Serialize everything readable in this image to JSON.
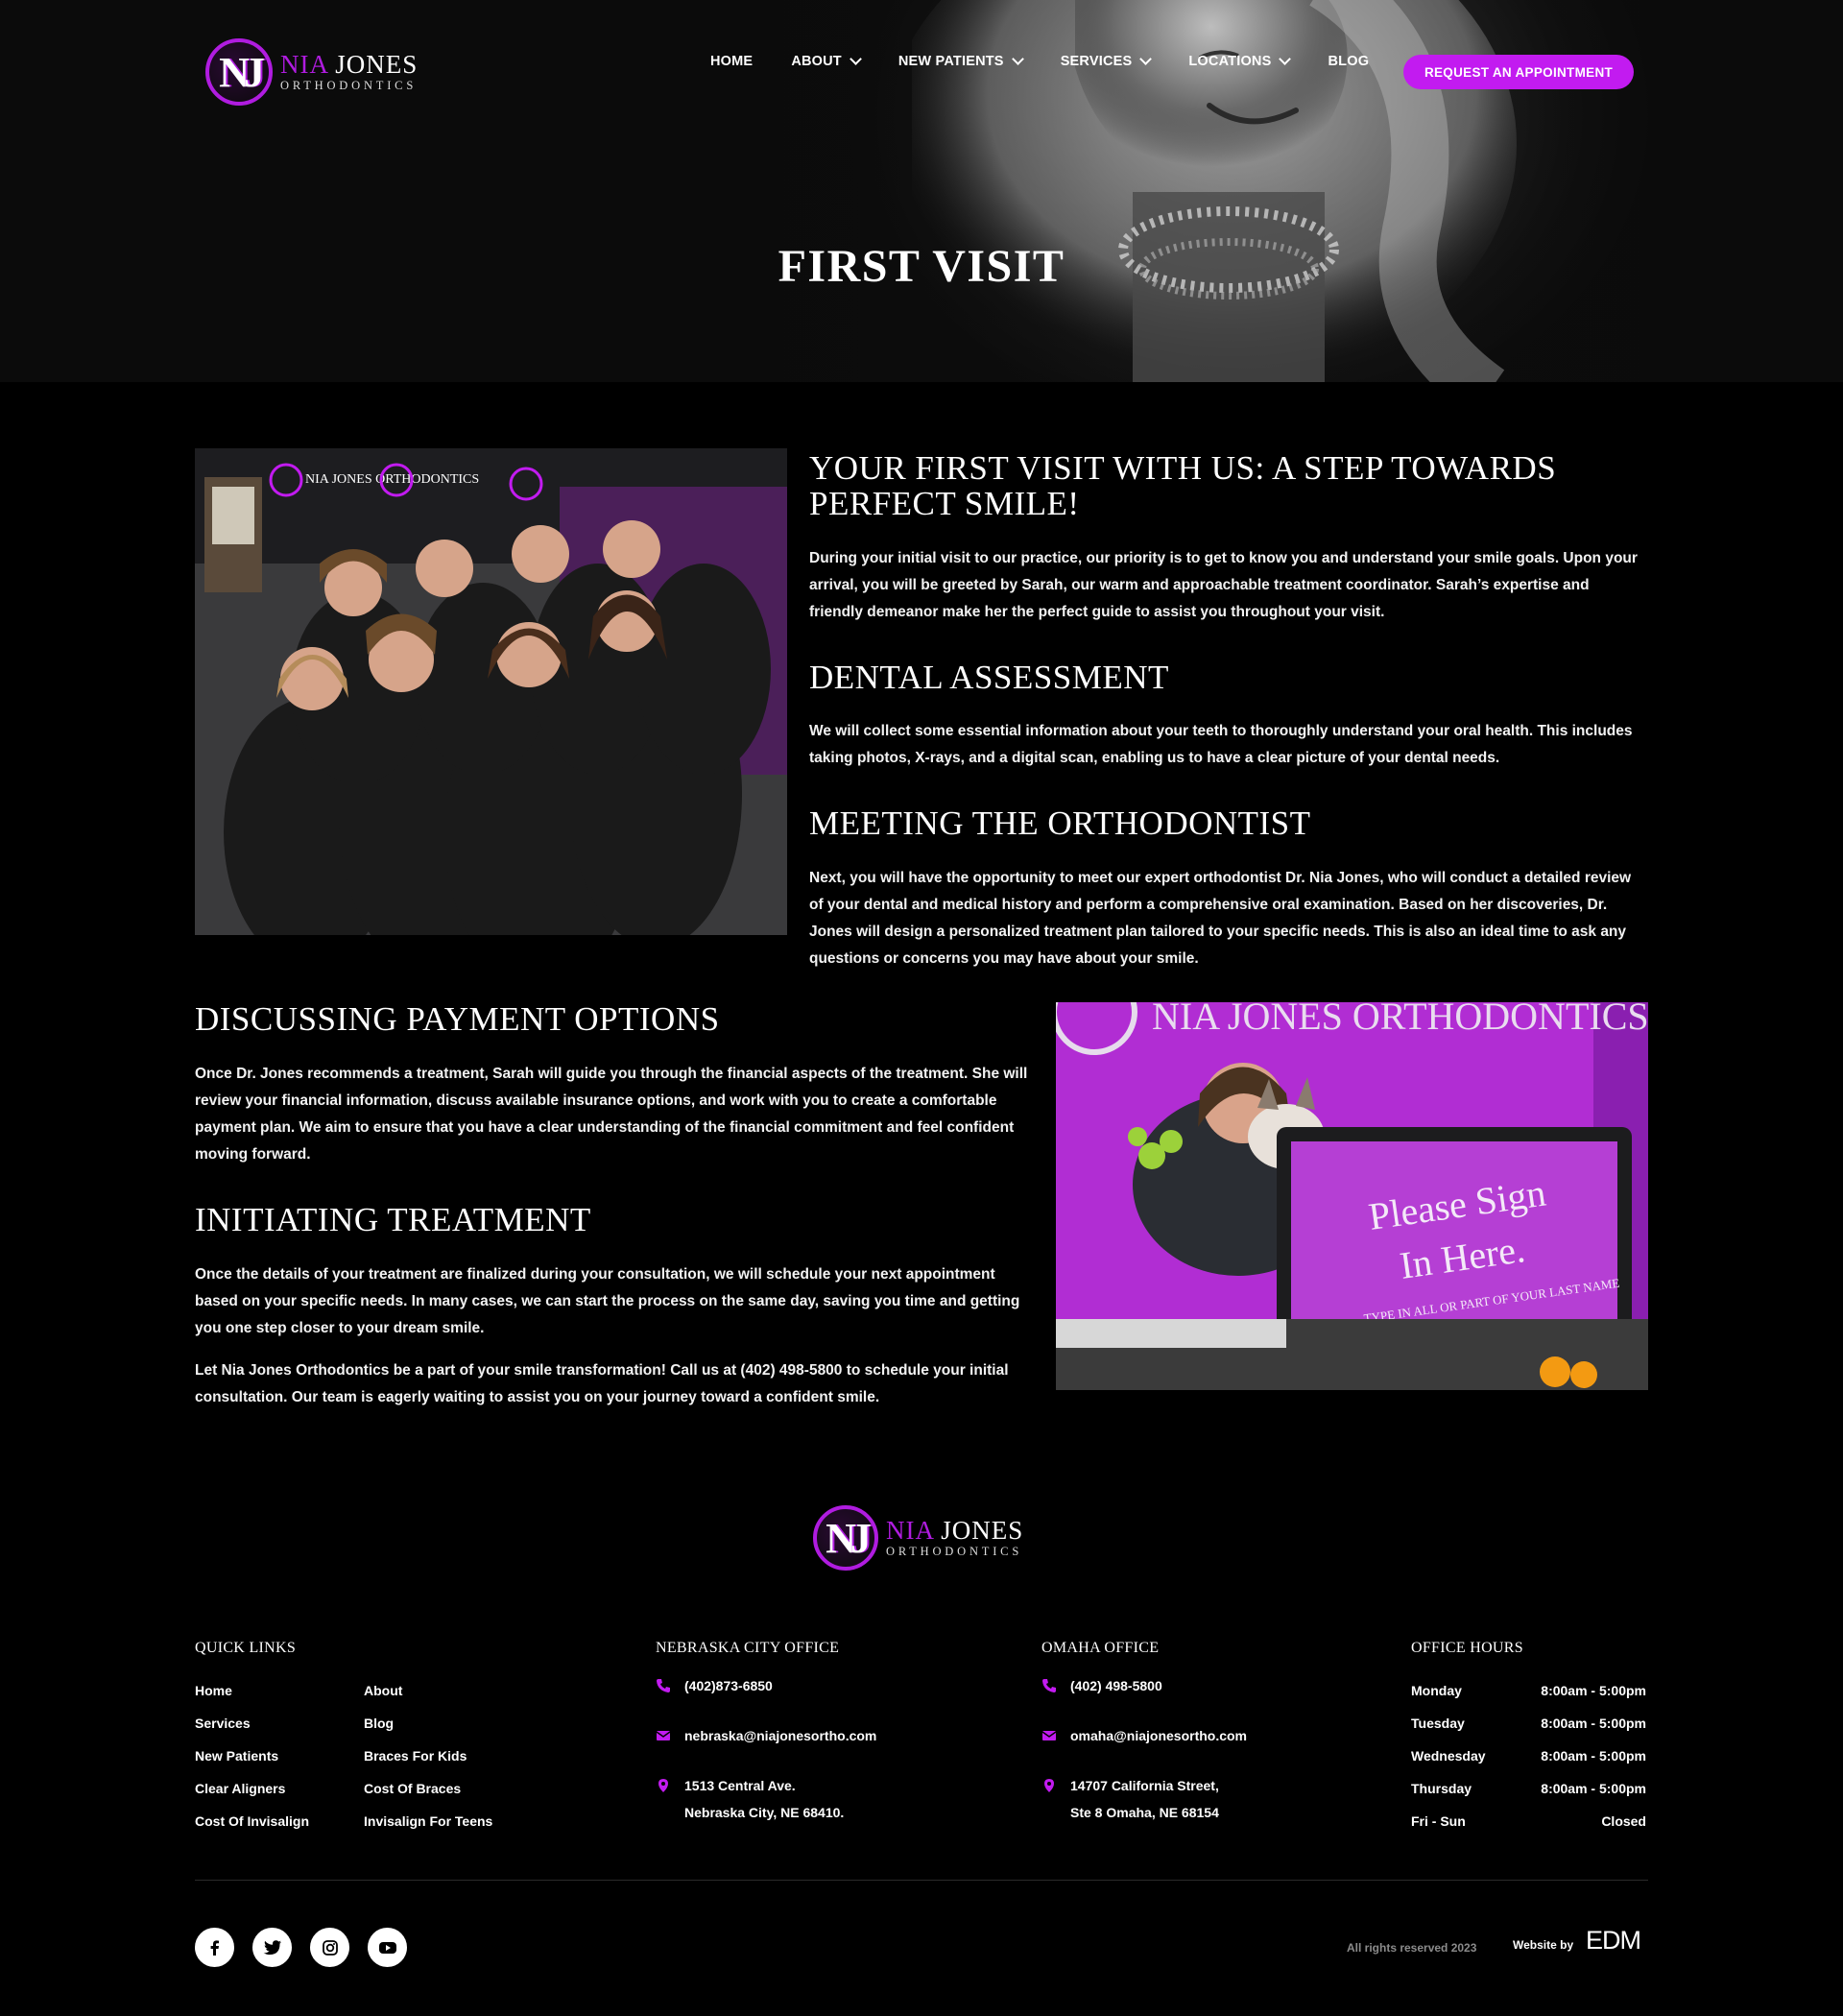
{
  "brand": {
    "monogram": "NJ",
    "name_first": "NIA",
    "name_last": "JONES",
    "subtitle": "ORTHODONTICS"
  },
  "nav": {
    "home": "HOME",
    "about": "ABOUT",
    "new_patients": "NEW PATIENTS",
    "services": "SERVICES",
    "locations": "LOCATIONS",
    "blog": "BLOG",
    "cta": "REQUEST AN APPOINTMENT"
  },
  "hero": {
    "title": "FIRST VISIT"
  },
  "sections": {
    "first_visit": {
      "heading": "YOUR FIRST VISIT WITH US: A STEP TOWARDS PERFECT SMILE!",
      "body": "During your initial visit to our practice, our priority is to get to know you and understand your smile goals. Upon your arrival, you will be greeted by Sarah, our warm and approachable treatment coordinator. Sarah’s expertise and friendly demeanor make her the perfect guide to assist you throughout your visit."
    },
    "dental_assessment": {
      "heading": "DENTAL ASSESSMENT",
      "body": "We will collect some essential information about your teeth to thoroughly understand your oral health. This includes taking photos, X-rays, and a digital scan, enabling us to have a clear picture of your dental needs."
    },
    "meeting": {
      "heading": "MEETING THE ORTHODONTIST",
      "body": "Next, you will have the opportunity to meet our expert orthodontist Dr. Nia Jones, who will conduct a detailed review of your dental and medical history and perform a comprehensive oral examination. Based on her discoveries, Dr. Jones will design a personalized treatment plan tailored to your specific needs. This is also an ideal time to ask any questions or concerns you may have about your smile."
    },
    "payment": {
      "heading": "DISCUSSING PAYMENT OPTIONS",
      "body": "Once Dr. Jones recommends a treatment, Sarah will guide you through the financial aspects of the treatment. She will review your financial information, discuss available insurance options, and work with you to create a comfortable payment plan. We aim to ensure that you have a clear understanding of the financial commitment and feel confident moving forward."
    },
    "treatment": {
      "heading": "INITIATING TREATMENT",
      "body": "Once the details of your treatment are finalized during your consultation, we will schedule your next appointment based on your specific needs. In many cases, we can start the process on the same day, saving you time and getting you one step closer to your dream smile.",
      "body2": "Let Nia Jones Orthodontics be a part of your smile transformation! Call us at (402) 498-5800 to schedule your initial consultation. Our team is eagerly waiting to assist you on your journey toward a confident smile."
    }
  },
  "photos": {
    "team_wall_text": "NIA JONES ORTHODONTICS",
    "sign_line1": "Please Sign",
    "sign_line2": "In Here.",
    "sign_line3": "TYPE IN ALL OR PART OF YOUR LAST NAME",
    "wall_text": "NIA JONES ORTHODONTICS"
  },
  "footer": {
    "quick_links": {
      "heading": "QUICK LINKS",
      "links": [
        "Home",
        "About",
        "Services",
        "Blog",
        "New Patients",
        "Braces For Kids",
        "Clear Aligners",
        "Cost Of Braces",
        "Cost Of Invisalign",
        "Invisalign For Teens"
      ]
    },
    "nebraska": {
      "heading": "NEBRASKA CITY OFFICE",
      "phone": "(402)873-6850",
      "email": "nebraska@niajonesortho.com",
      "address1": "1513 Central Ave.",
      "address2": "Nebraska City, NE 68410."
    },
    "omaha": {
      "heading": "OMAHA OFFICE",
      "phone": "(402) 498-5800",
      "email": "omaha@niajonesortho.com",
      "address1": "14707 California Street,",
      "address2": "Ste 8 Omaha, NE 68154"
    },
    "hours": {
      "heading": "OFFICE HOURS",
      "rows": [
        {
          "day": "Monday",
          "time": "8:00am - 5:00pm"
        },
        {
          "day": "Tuesday",
          "time": "8:00am - 5:00pm"
        },
        {
          "day": "Wednesday",
          "time": "8:00am - 5:00pm"
        },
        {
          "day": "Thursday",
          "time": "8:00am - 5:00pm"
        },
        {
          "day": "Fri - Sun",
          "time": "Closed"
        }
      ]
    },
    "socials": [
      "facebook-icon",
      "twitter-icon",
      "instagram-icon",
      "youtube-icon"
    ],
    "copyright": "All rights reserved 2023",
    "website_by": "Website by",
    "agency": "EDM"
  },
  "colors": {
    "accent": "#c21bf0",
    "background": "#000000",
    "text": "#ffffff"
  }
}
